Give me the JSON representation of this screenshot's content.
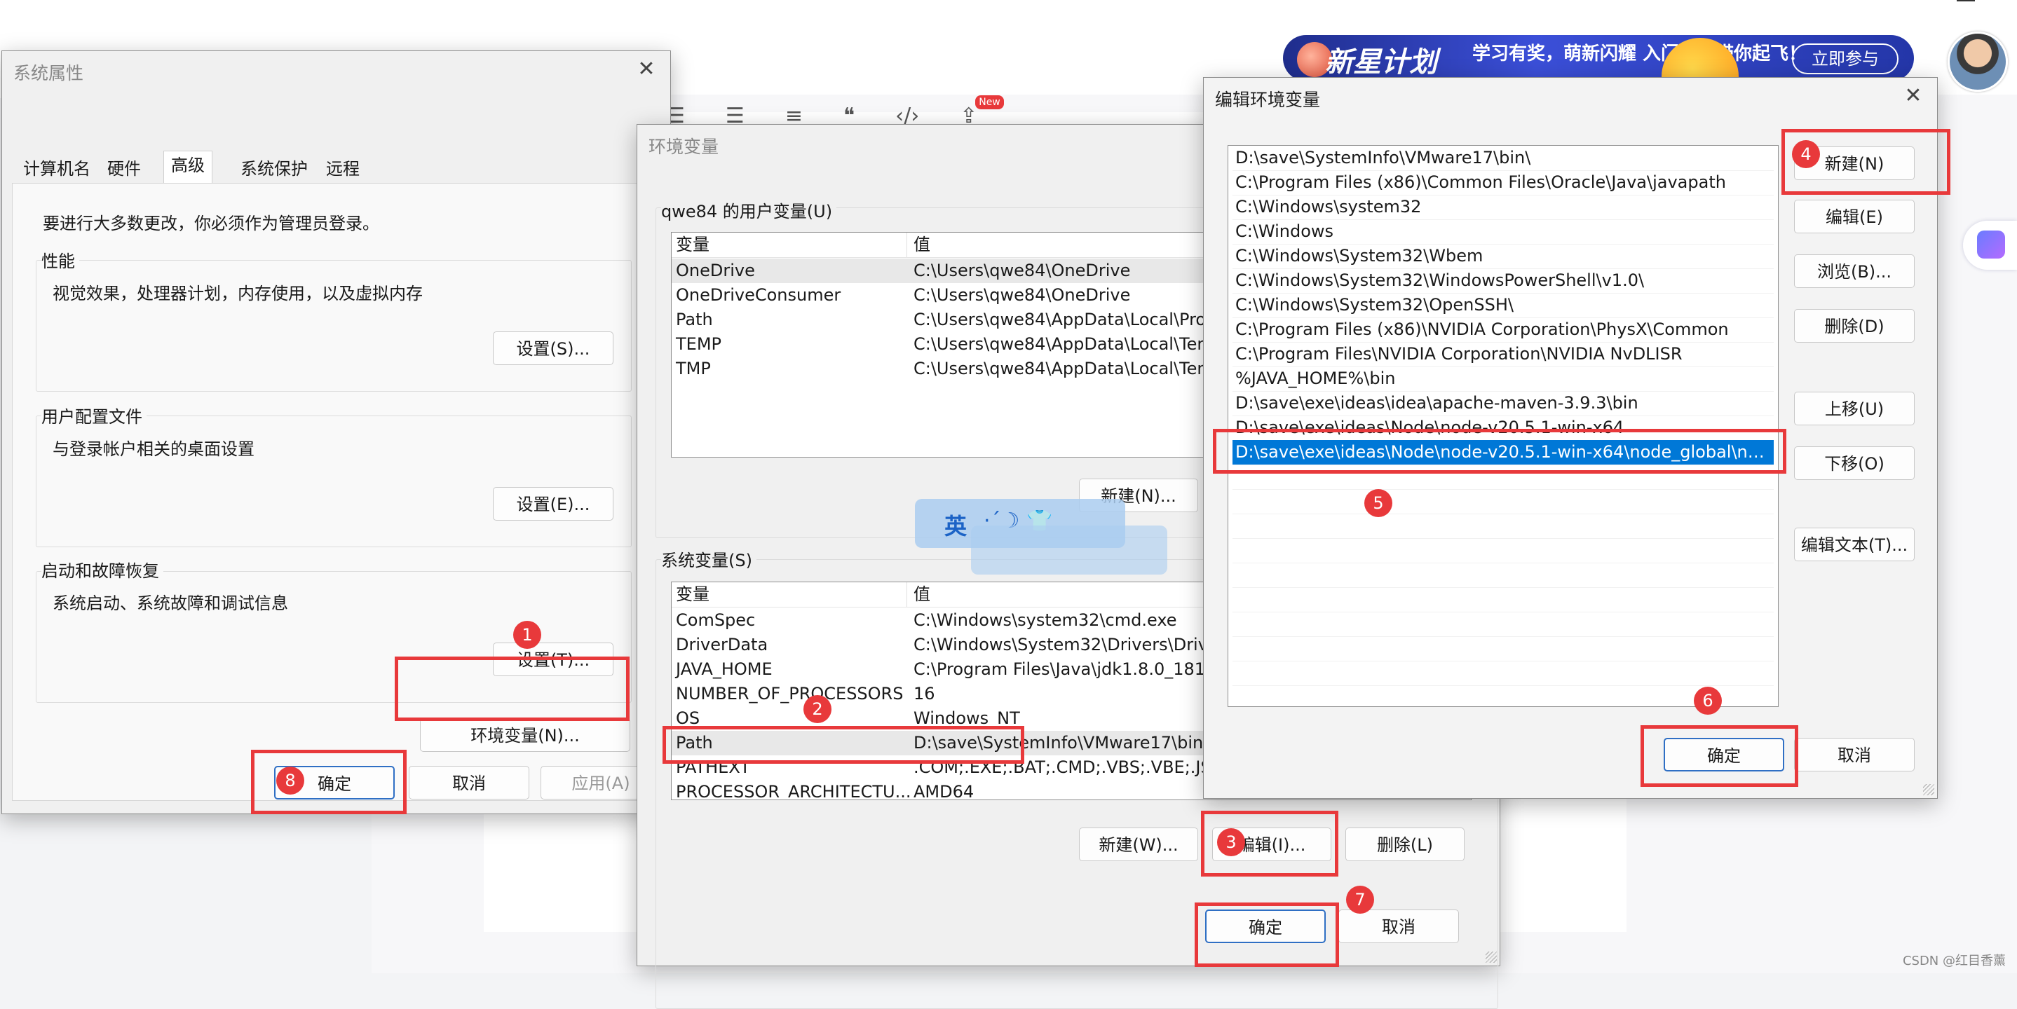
{
  "background": {
    "toolbar_icons": [
      "list-bulleted-icon",
      "list-numbered-icon",
      "indent-icon",
      "quote-icon",
      "code-icon",
      "upload-icon"
    ],
    "quote_glyph": "❝",
    "code_glyph": "‹/›",
    "new_badge": "New",
    "banner": {
      "title": "新星计划",
      "slogan": "学习有奖，萌新闪耀 入门导师带你起飞！",
      "button": "立即参与"
    },
    "watermark": "CSDN @红目香薰"
  },
  "ime": {
    "label": "英",
    "symbols": "·ˊ☽ 👕"
  },
  "system_properties": {
    "title": "系统属性",
    "tabs": [
      "计算机名",
      "硬件",
      "高级",
      "系统保护",
      "远程"
    ],
    "active_tab": "高级",
    "admin_note": "要进行大多数更改，你必须作为管理员登录。",
    "performance": {
      "label": "性能",
      "desc": "视觉效果，处理器计划，内存使用，以及虚拟内存",
      "button": "设置(S)..."
    },
    "user_profile": {
      "label": "用户配置文件",
      "desc": "与登录帐户相关的桌面设置",
      "button": "设置(E)..."
    },
    "startup": {
      "label": "启动和故障恢复",
      "desc": "系统启动、系统故障和调试信息",
      "button": "设置(T)..."
    },
    "env_button": "环境变量(N)...",
    "ok": "确定",
    "cancel": "取消",
    "apply": "应用(A)"
  },
  "environment_variables": {
    "title": "环境变量",
    "user_section": "qwe84 的用户变量(U)",
    "col_var": "变量",
    "col_val": "值",
    "user_vars": [
      {
        "name": "OneDrive",
        "value": "C:\\Users\\qwe84\\OneDrive"
      },
      {
        "name": "OneDriveConsumer",
        "value": "C:\\Users\\qwe84\\OneDrive"
      },
      {
        "name": "Path",
        "value": "C:\\Users\\qwe84\\AppData\\Local\\Pro"
      },
      {
        "name": "TEMP",
        "value": "C:\\Users\\qwe84\\AppData\\Local\\Tem"
      },
      {
        "name": "TMP",
        "value": "C:\\Users\\qwe84\\AppData\\Local\\Tem"
      }
    ],
    "user_new": "新建(N)...",
    "system_section": "系统变量(S)",
    "system_vars": [
      {
        "name": "ComSpec",
        "value": "C:\\Windows\\system32\\cmd.exe"
      },
      {
        "name": "DriverData",
        "value": "C:\\Windows\\System32\\Drivers\\Drive"
      },
      {
        "name": "JAVA_HOME",
        "value": "C:\\Program Files\\Java\\jdk1.8.0_181"
      },
      {
        "name": "NUMBER_OF_PROCESSORS",
        "value": "16"
      },
      {
        "name": "OS",
        "value": "Windows_NT"
      },
      {
        "name": "Path",
        "value": "D:\\save\\SystemInfo\\VMware17\\bin\\"
      },
      {
        "name": "PATHEXT",
        "value": ".COM;.EXE;.BAT;.CMD;.VBS;.VBE;.JS;."
      },
      {
        "name": "PROCESSOR_ARCHITECTU...",
        "value": "AMD64"
      }
    ],
    "sys_new": "新建(W)...",
    "sys_edit": "编辑(I)...",
    "sys_delete": "删除(L)",
    "ok": "确定",
    "cancel": "取消"
  },
  "edit_env": {
    "title": "编辑环境变量",
    "paths": [
      "D:\\save\\SystemInfo\\VMware17\\bin\\",
      "C:\\Program Files (x86)\\Common Files\\Oracle\\Java\\javapath",
      "C:\\Windows\\system32",
      "C:\\Windows",
      "C:\\Windows\\System32\\Wbem",
      "C:\\Windows\\System32\\WindowsPowerShell\\v1.0\\",
      "C:\\Windows\\System32\\OpenSSH\\",
      "C:\\Program Files (x86)\\NVIDIA Corporation\\PhysX\\Common",
      "C:\\Program Files\\NVIDIA Corporation\\NVIDIA NvDLISR",
      "%JAVA_HOME%\\bin",
      "D:\\save\\exe\\ideas\\idea\\apache-maven-3.9.3\\bin",
      "D:\\save\\exe\\ideas\\Node\\node-v20.5.1-win-x64",
      "D:\\save\\exe\\ideas\\Node\\node-v20.5.1-win-x64\\node_global\\nod..."
    ],
    "buttons": {
      "new": "新建(N)",
      "edit": "编辑(E)",
      "browse": "浏览(B)...",
      "delete": "删除(D)",
      "up": "上移(U)",
      "down": "下移(O)",
      "edit_text": "编辑文本(T)..."
    },
    "ok": "确定",
    "cancel": "取消"
  },
  "steps": [
    "1",
    "2",
    "3",
    "4",
    "5",
    "6",
    "7",
    "8"
  ],
  "colors": {
    "highlight": "#e8393b",
    "selection": "#0078d7",
    "primary_border": "#2f6fc4"
  }
}
